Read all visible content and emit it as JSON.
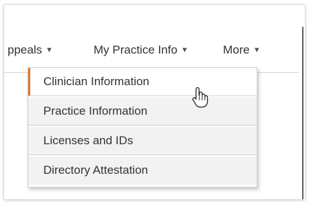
{
  "nav": {
    "items": [
      {
        "label": "ppeals",
        "caret": "▼"
      },
      {
        "label": "My Practice Info",
        "caret": "▼"
      },
      {
        "label": "More",
        "caret": "▼"
      }
    ],
    "active_index": 1
  },
  "dropdown": {
    "items": [
      {
        "label": "Clinician Information"
      },
      {
        "label": "Practice Information"
      },
      {
        "label": "Licenses and IDs"
      },
      {
        "label": "Directory Attestation"
      }
    ],
    "hovered_index": 0
  },
  "colors": {
    "accent": "#e0762e",
    "menu_bg": "#f2f2f2",
    "text": "#333333"
  },
  "icons": {
    "cursor": "hand-pointer-cursor-icon",
    "caret": "caret-down-icon"
  }
}
